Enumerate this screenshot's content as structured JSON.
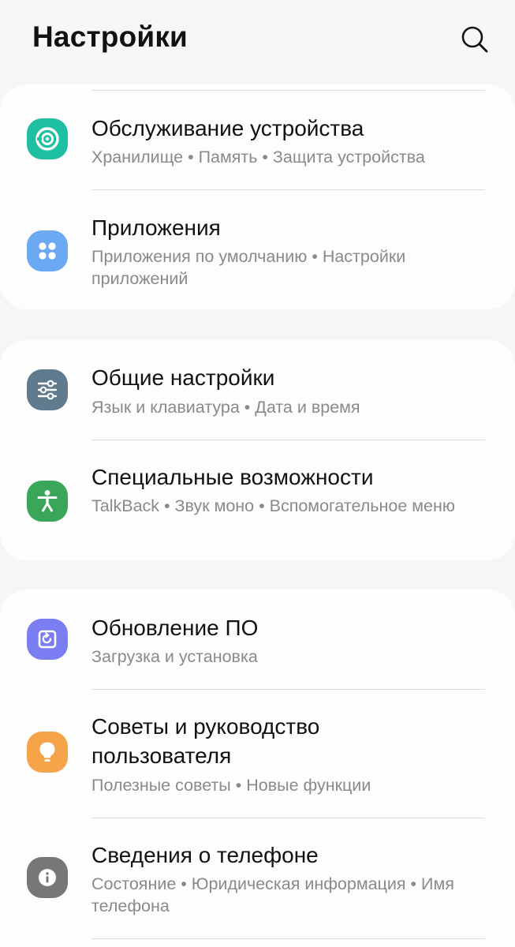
{
  "header": {
    "title": "Настройки",
    "search_icon": "search-icon"
  },
  "groups": [
    {
      "items": [
        {
          "key": "device-care",
          "icon": "device-care-icon",
          "icon_color": "#1fbfa2",
          "title": "Обслуживание устройства",
          "subtitle": "Хранилище  •  Память  •  Защита устройства"
        },
        {
          "key": "apps",
          "icon": "apps-grid-icon",
          "icon_color": "#6ba9f3",
          "title": "Приложения",
          "subtitle": "Приложения по умолчанию  •  Настройки приложений"
        }
      ]
    },
    {
      "items": [
        {
          "key": "general-management",
          "icon": "sliders-icon",
          "icon_color": "#607a8e",
          "title": "Общие настройки",
          "subtitle": "Язык и клавиатура  •  Дата и время"
        },
        {
          "key": "accessibility",
          "icon": "accessibility-icon",
          "icon_color": "#3aa65a",
          "title": "Специальные возможности",
          "subtitle": "TalkBack  •  Звук моно  •  Вспомогательное меню"
        }
      ]
    },
    {
      "items": [
        {
          "key": "software-update",
          "icon": "software-update-icon",
          "icon_color": "#7b7ef2",
          "title": "Обновление ПО",
          "subtitle": "Загрузка и установка"
        },
        {
          "key": "tips",
          "icon": "lightbulb-icon",
          "icon_color": "#f5a44a",
          "title": "Советы и руководство пользователя",
          "subtitle": "Полезные советы  •  Новые функции"
        },
        {
          "key": "about-phone",
          "icon": "info-icon",
          "icon_color": "#777777",
          "title": "Сведения о телефоне",
          "subtitle": "Состояние  •  Юридическая информация  •  Имя телефона"
        }
      ]
    }
  ]
}
